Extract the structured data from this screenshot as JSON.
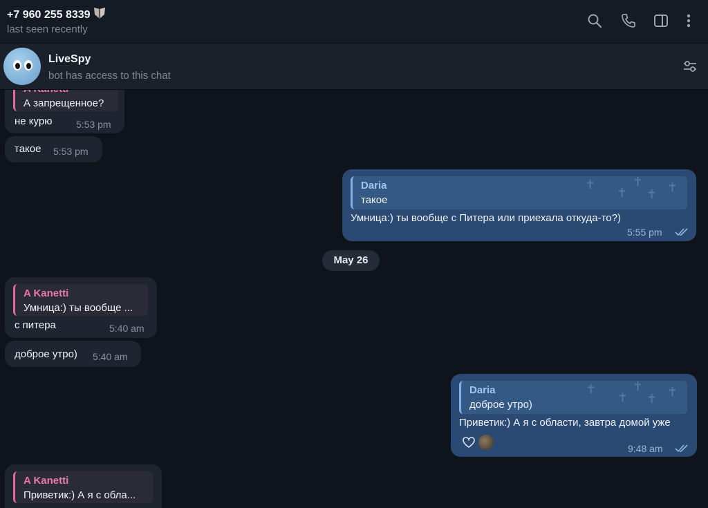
{
  "header": {
    "contact_name": "+7 960 255 8339",
    "status": "last seen recently",
    "icons": [
      "search-icon",
      "phone-icon",
      "sidebar-icon",
      "more-vertical-icon"
    ]
  },
  "bot_bar": {
    "name": "LiveSpy",
    "subtitle": "bot has access to this chat",
    "icon": "settings-sliders-icon"
  },
  "messages": [
    {
      "dir": "in",
      "quote_author": "A Kanetti",
      "quote_text": "А запрещенное?",
      "text": "не курю",
      "time": "5:53 pm"
    },
    {
      "dir": "in",
      "text": "такое",
      "time": "5:53 pm"
    },
    {
      "dir": "out",
      "quote_author": "Daria",
      "quote_text": "такое",
      "text": "Умница:) ты вообще с Питера или приехала откуда-то?)",
      "time": "5:55 pm",
      "status": "read"
    },
    {
      "dir": "in",
      "quote_author": "A Kanetti",
      "quote_text": "Умница:) ты вообще ...",
      "text": "с питера",
      "time": "5:40 am"
    },
    {
      "dir": "in",
      "text": "доброе утро)",
      "time": "5:40 am"
    },
    {
      "dir": "out",
      "quote_author": "Daria",
      "quote_text": "доброе утро)",
      "text": "Приветик:) А я с области, завтра домой уже",
      "time": "9:48 am",
      "status": "read"
    },
    {
      "dir": "in",
      "quote_author": "A Kanetti",
      "quote_text": "Приветик:) А я с обла..."
    }
  ],
  "date_separator": "May 26",
  "colors": {
    "background": "#0f141c",
    "incoming_bubble": "#1e2530",
    "outgoing_bubble": "#2b4a73",
    "quote_author_in": "#e87aa3",
    "quote_author_out": "#9cc6f2"
  }
}
